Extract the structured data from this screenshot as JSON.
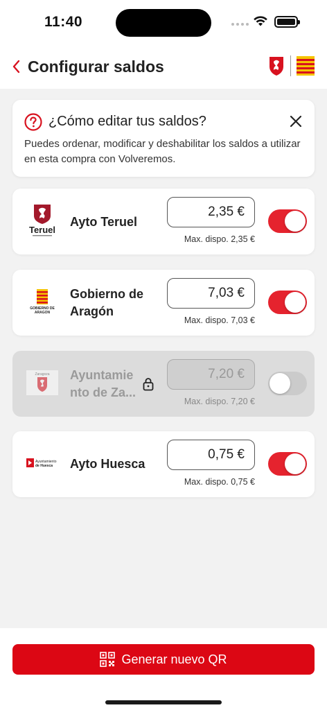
{
  "status": {
    "time": "11:40"
  },
  "header": {
    "title": "Configurar saldos",
    "back_icon": "chevron-left-icon"
  },
  "info": {
    "title": "¿Cómo editar tus saldos?",
    "text": "Puedes ordenar, modificar y deshabilitar los saldos a utilizar en esta compra con Volveremos."
  },
  "balances": [
    {
      "name": "Ayto Teruel",
      "logo_text": "Teruel",
      "amount": "2,35  €",
      "max": "Max. dispo. 2,35 €",
      "enabled": true
    },
    {
      "name": "Gobierno de Aragón",
      "logo_text": "GOBIERNO DE ARAGON",
      "amount": "7,03  €",
      "max": "Max. dispo. 7,03 €",
      "enabled": true
    },
    {
      "name": "Ayuntamie nto de Za...",
      "logo_text": "Zaragoza",
      "amount": "7,20  €",
      "max": "Max. dispo. 7,20 €",
      "enabled": false
    },
    {
      "name": "Ayto Huesca",
      "logo_text": "Ayuntamiento de Huesca",
      "amount": "0,75  €",
      "max": "Max. dispo. 0,75 €",
      "enabled": true
    }
  ],
  "footer": {
    "button_label": "Generar nuevo QR"
  },
  "colors": {
    "accent": "#dc0714",
    "toggle_on": "#e5232e",
    "toggle_off": "#cbcbcb"
  }
}
